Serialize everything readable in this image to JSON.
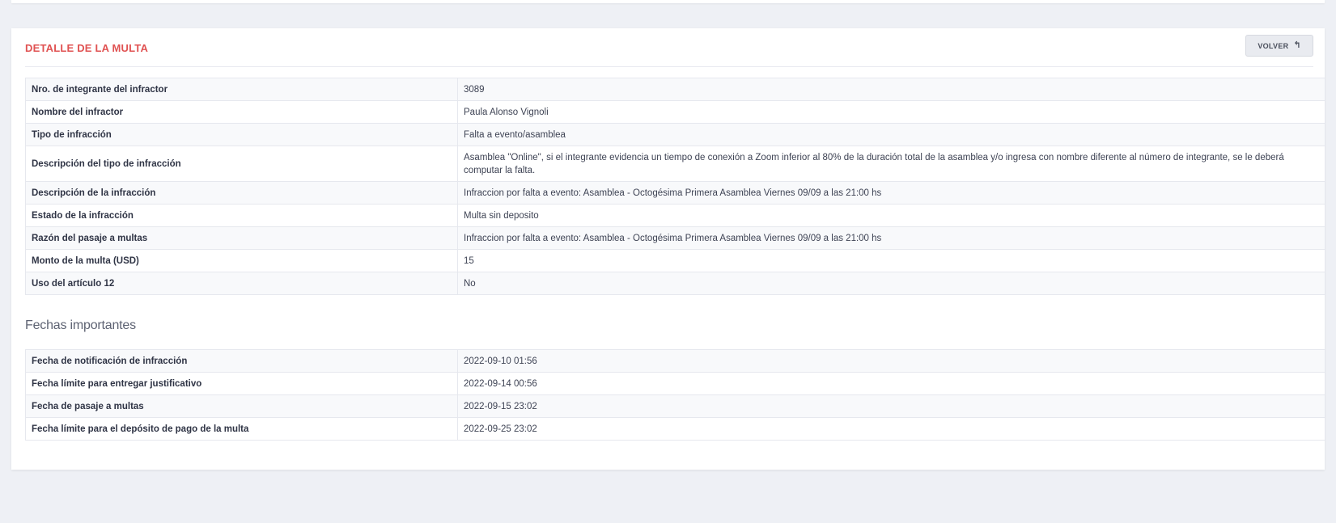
{
  "panel": {
    "title": "DETALLE DE LA MULTA",
    "back_label": "VOLVER"
  },
  "details": [
    {
      "label": "Nro. de integrante del infractor",
      "value": "3089"
    },
    {
      "label": "Nombre del infractor",
      "value": "Paula Alonso Vignoli"
    },
    {
      "label": "Tipo de infracción",
      "value": "Falta a evento/asamblea"
    },
    {
      "label": "Descripción del tipo de infracción",
      "value": "Asamblea \"Online\", si el integrante evidencia un tiempo de conexión a Zoom inferior al 80% de la duración total de la asamblea y/o ingresa con nombre diferente al número de integrante, se le deberá computar la falta."
    },
    {
      "label": "Descripción de la infracción",
      "value": "Infraccion por falta a evento: Asamblea - Octogésima Primera Asamblea Viernes 09/09 a las 21:00 hs"
    },
    {
      "label": "Estado de la infracción",
      "value": "Multa sin deposito"
    },
    {
      "label": "Razón del pasaje a multas",
      "value": "Infraccion por falta a evento: Asamblea - Octogésima Primera Asamblea Viernes 09/09 a las 21:00 hs"
    },
    {
      "label": "Monto de la multa (USD)",
      "value": "15"
    },
    {
      "label": "Uso del artículo 12",
      "value": "No"
    }
  ],
  "dates_section": {
    "title": "Fechas importantes",
    "rows": [
      {
        "label": "Fecha de notificación de infracción",
        "value": "2022-09-10 01:56"
      },
      {
        "label": "Fecha límite para entregar justificativo",
        "value": "2022-09-14 00:56"
      },
      {
        "label": "Fecha de pasaje a multas",
        "value": "2022-09-15 23:02"
      },
      {
        "label": "Fecha límite para el depósito de pago de la multa",
        "value": "2022-09-25 23:02"
      }
    ]
  }
}
